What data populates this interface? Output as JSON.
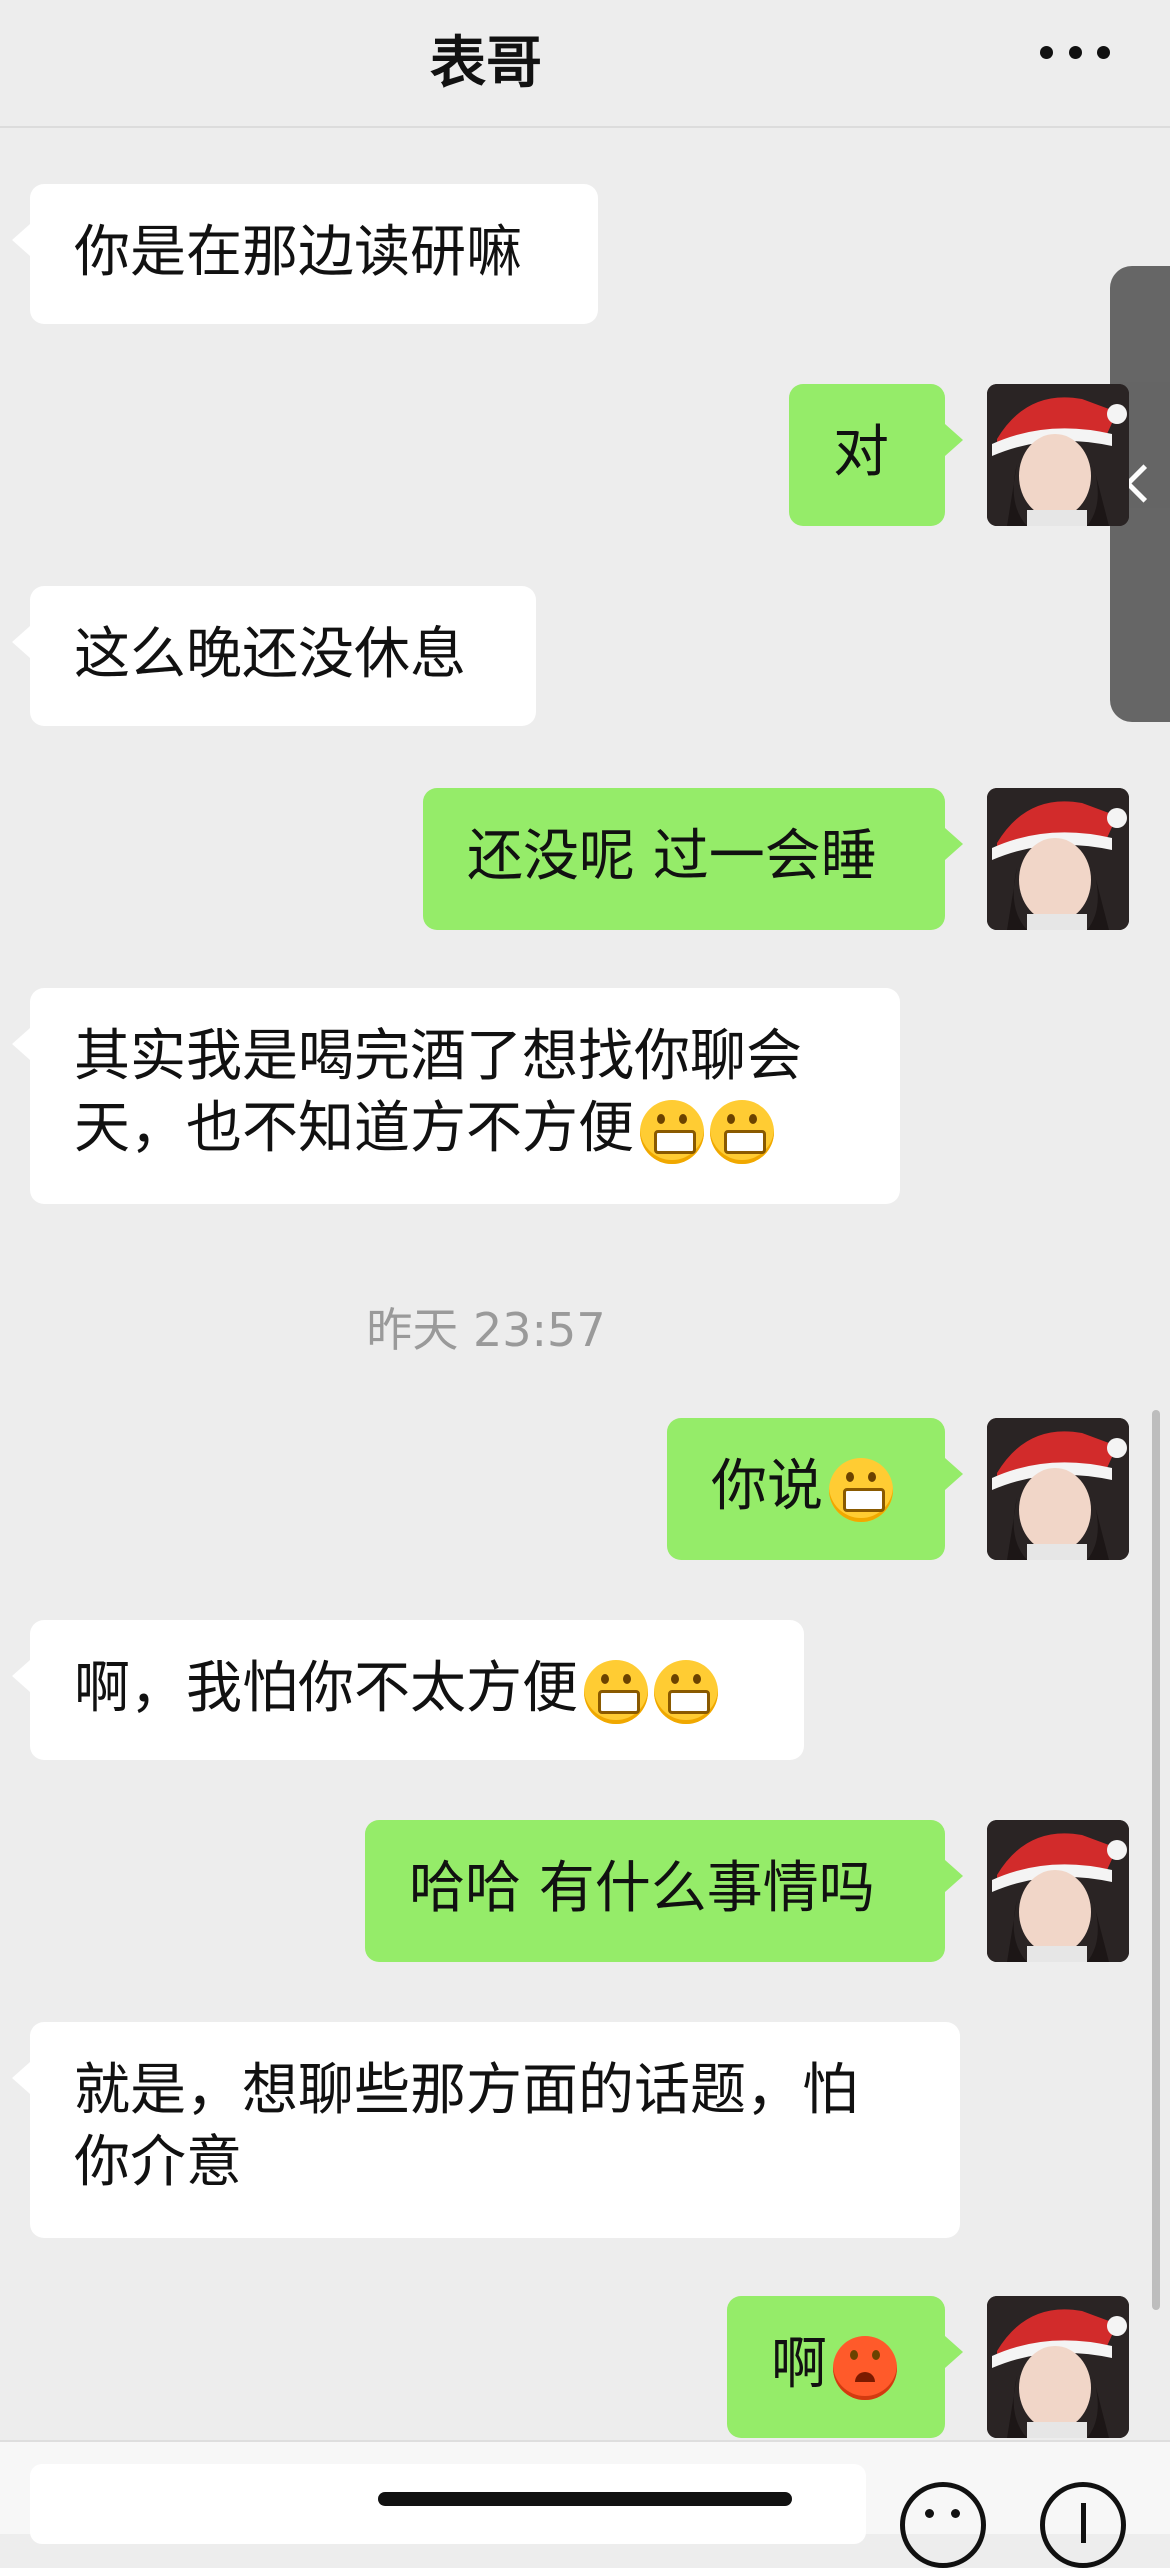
{
  "header": {
    "title": "表哥"
  },
  "messages": [
    {
      "side": "left",
      "text": "你是在那边读研嘛"
    },
    {
      "side": "right",
      "text": "对"
    },
    {
      "side": "left",
      "text": "这么晚还没休息"
    },
    {
      "side": "right",
      "text": "还没呢 过一会睡"
    },
    {
      "side": "left",
      "text_line1": "其实我是喝完酒了想找你聊会",
      "text_line2": "天，也不知道方不方便",
      "emoji": "grinning-face-emoji"
    },
    {
      "side": "right",
      "text": "你说",
      "emoji": "grinning-face-emoji"
    },
    {
      "side": "left",
      "text": "啊，我怕你不太方便",
      "emoji": "grinning-face-emoji"
    },
    {
      "side": "right",
      "text": "哈哈 有什么事情吗"
    },
    {
      "side": "left",
      "text_line1": "就是，想聊些那方面的话题，怕",
      "text_line2": "你介意"
    },
    {
      "side": "right",
      "text": "啊",
      "emoji": "anxious-sweat-face-emoji"
    }
  ],
  "timestamp": "昨天 23:57",
  "colors": {
    "background": "#ededed",
    "incoming_bubble": "#ffffff",
    "outgoing_bubble": "#95ec69"
  }
}
